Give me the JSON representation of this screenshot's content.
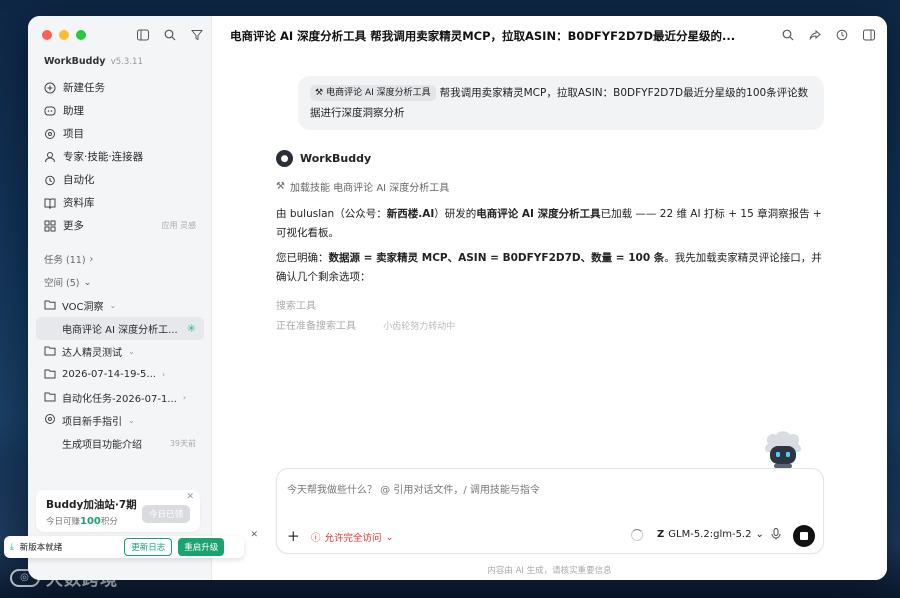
{
  "sidebar": {
    "brand": "WorkBuddy",
    "version": "v5.3.11",
    "nav": [
      {
        "label": "新建任务",
        "icon": "plus-circle-icon",
        "extra": ""
      },
      {
        "label": "助理",
        "icon": "assistant-icon",
        "extra": ""
      },
      {
        "label": "项目",
        "icon": "project-icon",
        "extra": ""
      },
      {
        "label": "专家·技能·连接器",
        "icon": "expert-icon",
        "extra": ""
      },
      {
        "label": "自动化",
        "icon": "alarm-icon",
        "extra": ""
      },
      {
        "label": "资料库",
        "icon": "library-icon",
        "extra": ""
      },
      {
        "label": "更多",
        "icon": "grid-icon",
        "extra": "应用 灵感"
      }
    ],
    "tasks_label": "任务 (11)",
    "spaces_label": "空间 (5)",
    "tree": [
      {
        "label": "VOC洞察",
        "type": "folder",
        "arrow": "⌄"
      },
      {
        "label": "电商评论 AI 深度分析工...",
        "type": "sub-active",
        "spinner": "✳"
      },
      {
        "label": "达人精灵测试",
        "type": "folder",
        "arrow": "⌄"
      },
      {
        "label": "2026-07-14-19-5...",
        "type": "folder",
        "arrow": "›"
      },
      {
        "label": "自动化任务-2026-07-1...",
        "type": "folder",
        "arrow": "›"
      },
      {
        "label": "项目新手指引",
        "type": "guide",
        "arrow": "⌄"
      },
      {
        "label": "生成项目功能介绍",
        "type": "sub",
        "time": "39天前"
      }
    ],
    "promo": {
      "title": "Buddy加油站·7期",
      "sub_prefix": "今日可赚",
      "points": "100",
      "sub_suffix": "积分",
      "button": "今日已领"
    },
    "update": {
      "text": "新版本就绪",
      "log_button": "更新日志",
      "restart_button": "重启升级"
    }
  },
  "main": {
    "title": "电商评论 AI 深度分析工具 帮我调用卖家精灵MCP，拉取ASIN：B0DFYF2D7D最近分星级的...",
    "user_message": {
      "chip": "电商评论 AI 深度分析工具",
      "text": "帮我调用卖家精灵MCP，拉取ASIN：B0DFYF2D7D最近分星级的100条评论数据进行深度洞察分析"
    },
    "bot_name": "WorkBuddy",
    "skill_line": "加载技能 电商评论 AI 深度分析工具",
    "para1": {
      "p1": "由 buluslan（公众号：",
      "b1": "新西楼.AI",
      "p2": "）研发的",
      "b2": "电商评论 AI 深度分析工具",
      "p3": "已加载 —— 22 维 AI 打标 + 15 章洞察报告 + 可视化看板。"
    },
    "para2": {
      "p1": "您已明确：",
      "b1": "数据源 = 卖家精灵 MCP、ASIN = B0DFYF2D7D、数量 = 100 条",
      "p2": "。我先加载卖家精灵评论接口，并确认几个剩余选项："
    },
    "tool1": "搜索工具",
    "tool2": "正在准备搜索工具",
    "tool2_sub": "小齿轮努力转动中",
    "composer": {
      "placeholder": "今天帮我做些什么？ @ 引用对话文件，/ 调用技能与指令",
      "permission": "允许完全访问",
      "model": "GLM-5.2:glm-5.2"
    },
    "footer_note": "内容由 AI 生成，请核实重要信息"
  },
  "watermark": "大数跨境"
}
